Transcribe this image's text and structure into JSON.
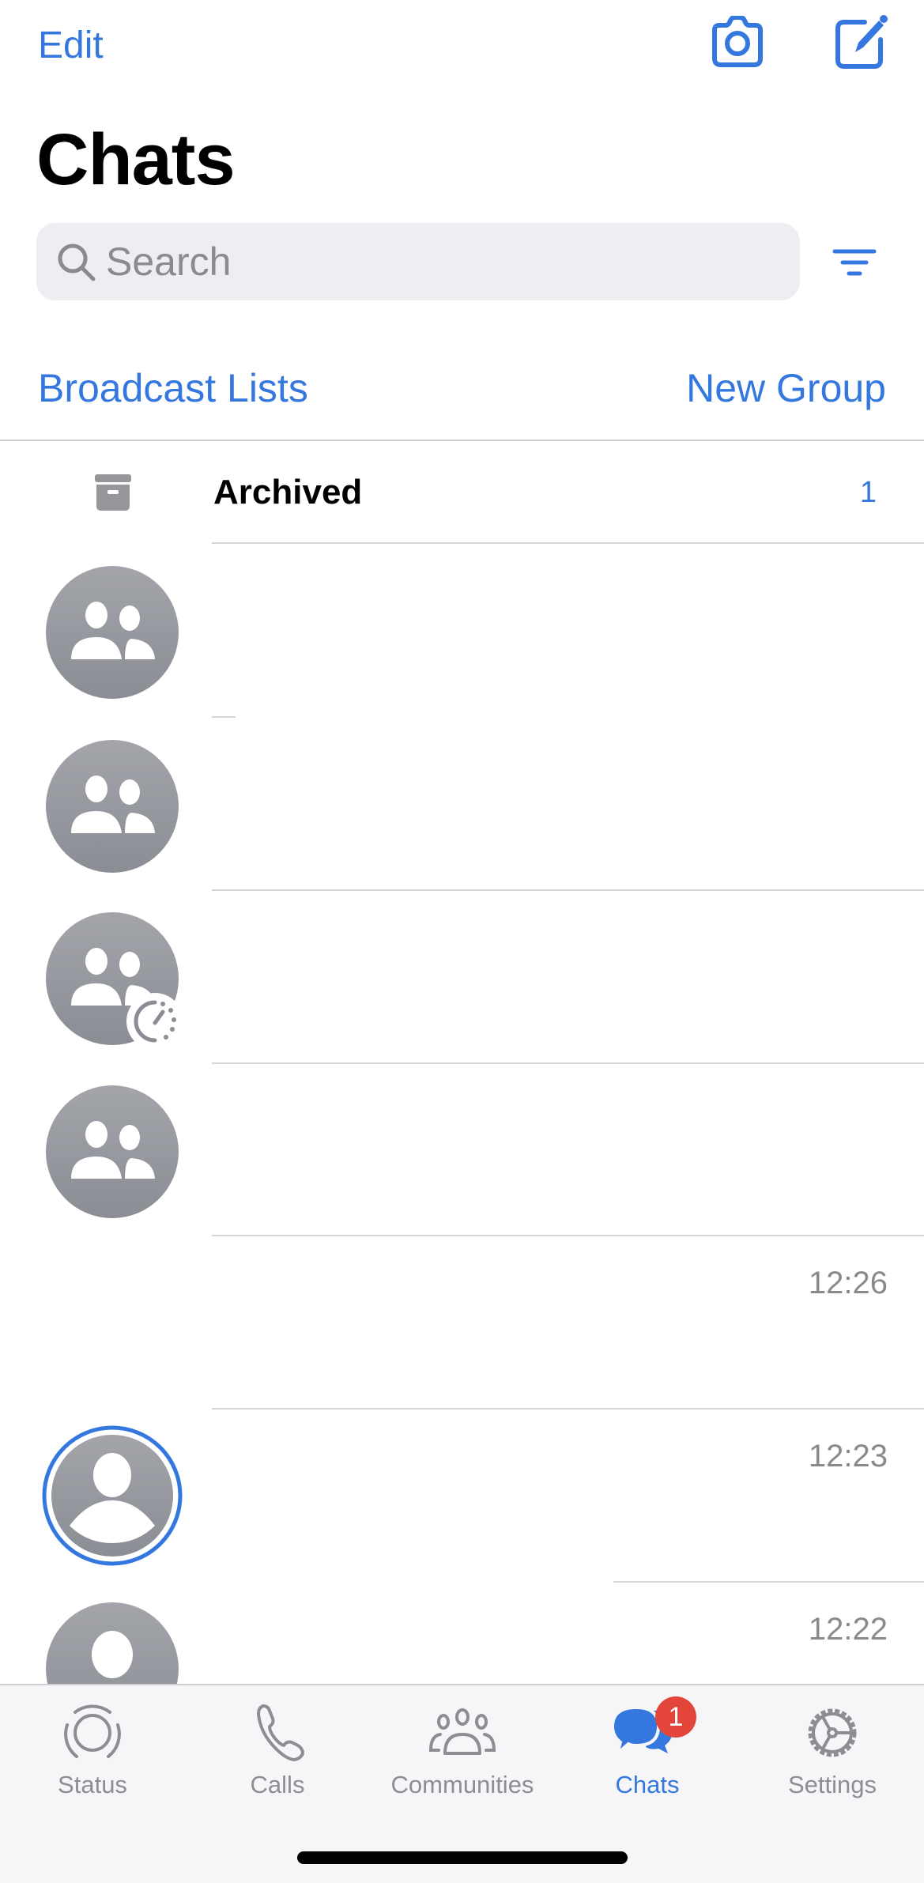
{
  "header": {
    "edit_label": "Edit",
    "camera_icon": "camera-icon",
    "compose_icon": "compose-icon",
    "title": "Chats"
  },
  "search": {
    "placeholder": "Search",
    "value": "",
    "filter_icon": "filter-icon"
  },
  "actions": {
    "broadcast_label": "Broadcast Lists",
    "new_group_label": "New Group"
  },
  "archived": {
    "label": "Archived",
    "count": "1",
    "icon": "archive-box-icon"
  },
  "chats": [
    {
      "avatar": "group",
      "name": "",
      "time": "",
      "badge": null
    },
    {
      "avatar": "group",
      "name": "",
      "time": "",
      "badge": null
    },
    {
      "avatar": "group",
      "name": "",
      "time": "",
      "badge": "disappearing-timer"
    },
    {
      "avatar": "group",
      "name": "",
      "time": "",
      "badge": null
    },
    {
      "avatar": "none",
      "name": "",
      "time": "12:26",
      "badge": null
    },
    {
      "avatar": "person-status-ring",
      "name": "",
      "time": "12:23",
      "badge": null
    },
    {
      "avatar": "person",
      "name": "",
      "time": "12:22",
      "badge": null
    }
  ],
  "tabs": [
    {
      "label": "Status",
      "icon": "status-icon",
      "active": false
    },
    {
      "label": "Calls",
      "icon": "phone-icon",
      "active": false
    },
    {
      "label": "Communities",
      "icon": "communities-icon",
      "active": false
    },
    {
      "label": "Chats",
      "icon": "chats-bubbles-icon",
      "active": true,
      "badge": "1"
    },
    {
      "label": "Settings",
      "icon": "gear-icon",
      "active": false
    }
  ],
  "colors": {
    "accent": "#3478df",
    "badge": "#e4453a",
    "avatar_gray": "#9a9ca3",
    "secondary_text": "#8a8a8e"
  }
}
